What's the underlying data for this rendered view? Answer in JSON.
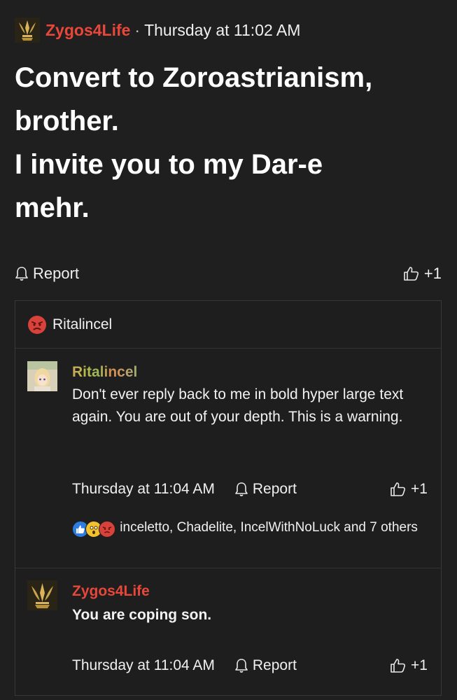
{
  "post": {
    "author": "Zygos4Life",
    "separator": "·",
    "time": "Thursday at 11:02 AM",
    "body_line1": "Convert to Zoroastrianism,",
    "body_line2": "brother.",
    "body_line3": "I invite you to my Dar-e",
    "body_line4": "mehr.",
    "report_label": "Report",
    "like_label": "+1"
  },
  "quote": {
    "header_label": "Ritalincel",
    "header_icon": "angry-face-icon"
  },
  "replies": [
    {
      "author": "Ritalincel",
      "text": "Don't ever reply back to me in bold hyper large text again. You are out of your depth. This is a warning.",
      "time": "Thursday at 11:04 AM",
      "report_label": "Report",
      "like_label": "+1",
      "reactions_text": "inceletto, Chadelite, IncelWithNoLuck and 7 others",
      "reaction_icons": [
        "thumbs-up-icon",
        "surprised-face-icon",
        "angry-face-icon"
      ]
    },
    {
      "author": "Zygos4Life",
      "text": "You are coping son.",
      "time": "Thursday at 11:04 AM",
      "report_label": "Report",
      "like_label": "+1"
    }
  ],
  "colors": {
    "background": "#1f1f1f",
    "author_red": "#e8473a",
    "text": "#ececec",
    "like_blue": "#2d7de0",
    "angry_red": "#d9423b"
  }
}
